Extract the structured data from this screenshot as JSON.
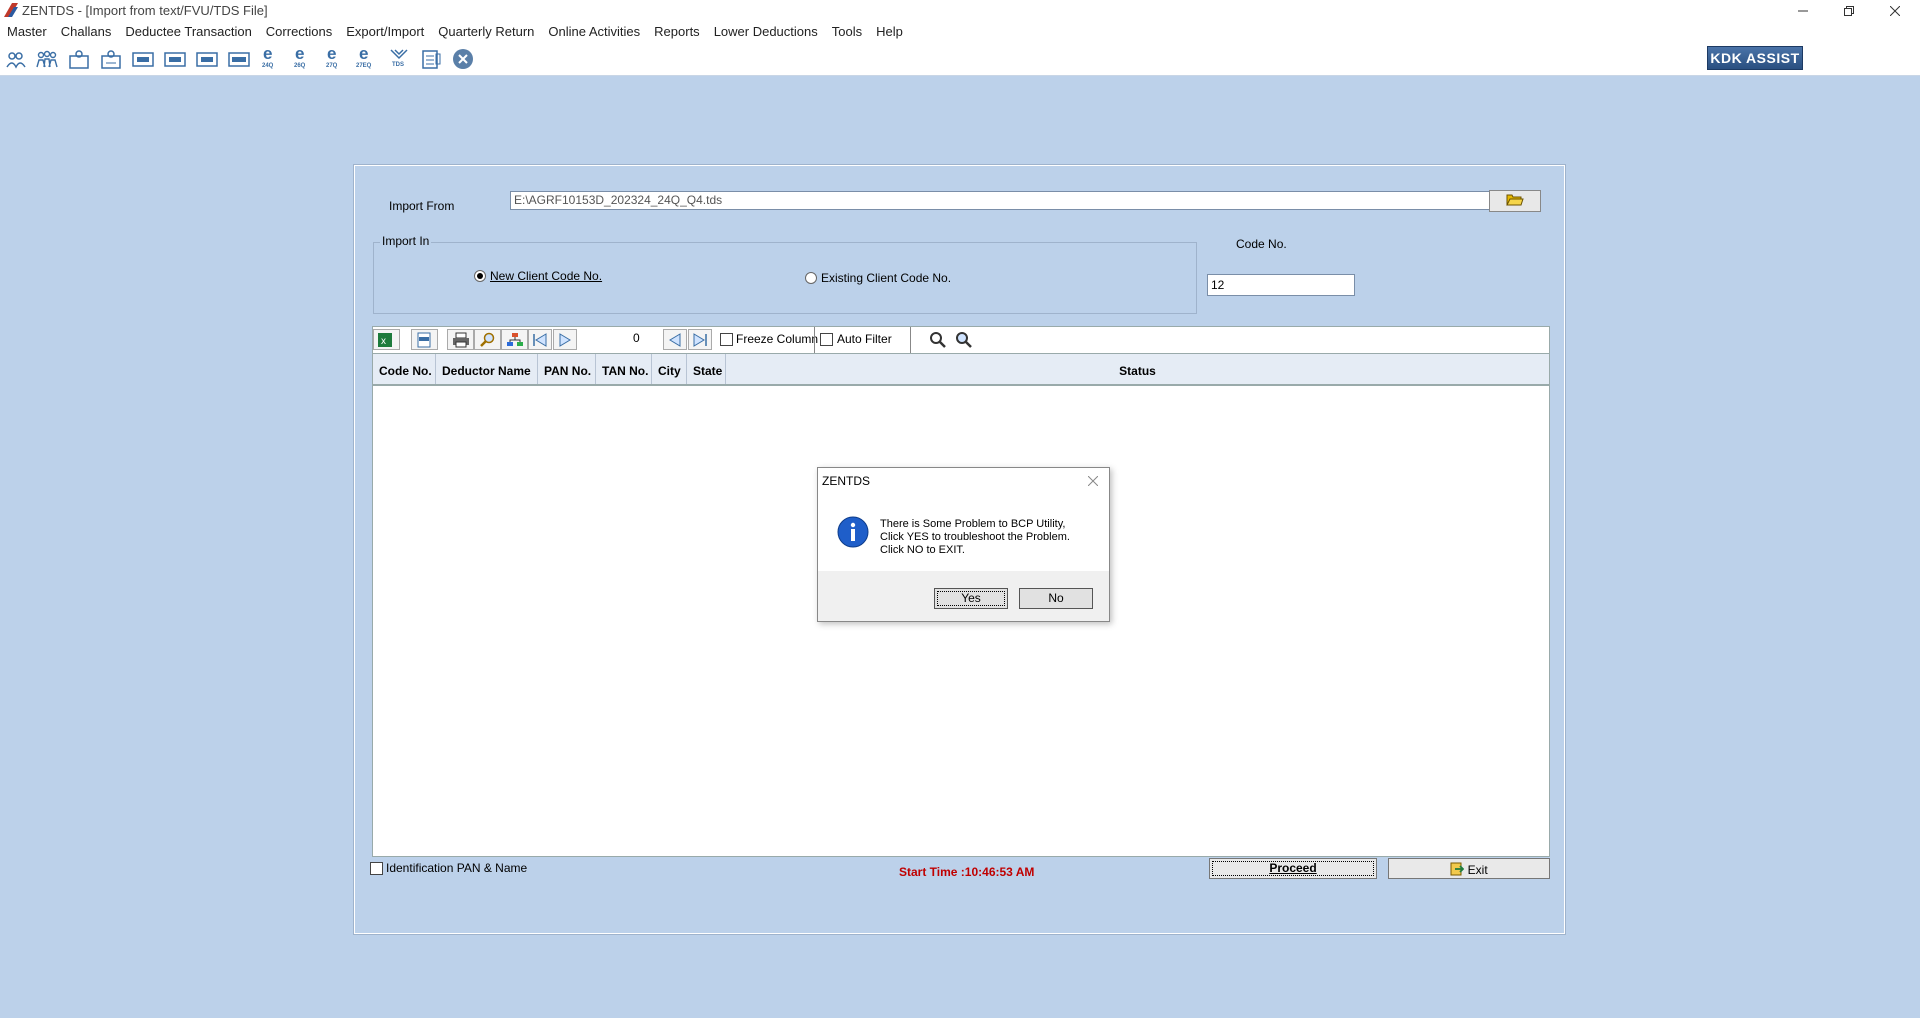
{
  "window": {
    "title": "ZENTDS - [Import from text/FVU/TDS File]"
  },
  "menu": [
    "Master",
    "Challans",
    "Deductee Transaction",
    "Corrections",
    "Export/Import",
    "Quarterly Return",
    "Online Activities",
    "Reports",
    "Lower Deductions",
    "Tools",
    "Help"
  ],
  "toolbar": {
    "icons": [
      "deductor-icon",
      "deductees-icon",
      "employee-icon",
      "employee-2-icon",
      "form-16-icon",
      "form-16a-icon",
      "form-27d-icon",
      "form-27eq-icon",
      "e-24q-icon",
      "e-26q-icon",
      "e-27q-icon",
      "e-27eq-icon",
      "tds-icon",
      "notes-icon",
      "close-circle-icon"
    ],
    "e_labels": [
      "24Q",
      "26Q",
      "27Q",
      "27EQ"
    ],
    "tds_label": "TDS",
    "kdk_label": "KDK ASSIST"
  },
  "form": {
    "import_from_label": "Import From",
    "import_from_value": "E:\\AGRF10153D_202324_24Q_Q4.tds",
    "import_in_label": "Import In",
    "new_client_label": "New Client Code No.",
    "existing_client_label": "Existing Client Code No.",
    "code_no_label": "Code No.",
    "code_no_value": "12"
  },
  "gridbar": {
    "record_count": "0",
    "freeze_column_label": "Freeze Column",
    "auto_filter_label": "Auto Filter"
  },
  "grid": {
    "columns": [
      "Code No.",
      "Deductor Name",
      "PAN No.",
      "TAN No.",
      "City",
      "State",
      "Status"
    ]
  },
  "footer": {
    "identification_label": "Identification PAN & Name",
    "start_time": "Start Time :10:46:53 AM",
    "proceed_label": "Proceed",
    "exit_label": "Exit"
  },
  "dialog": {
    "title": "ZENTDS",
    "line1": "There is Some Problem to BCP Utility,",
    "line2": "Click YES to troubleshoot the Problem.",
    "line3": "Click NO to EXIT.",
    "yes_label": "Yes",
    "no_label": "No"
  },
  "colors": {
    "background": "#bcd1ea",
    "accent": "#2a4f80",
    "start_time": "#c00000"
  }
}
